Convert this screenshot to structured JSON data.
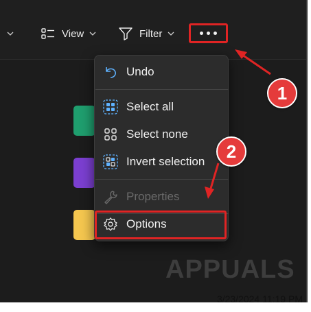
{
  "toolbar": {
    "view_label": "View",
    "filter_label": "Filter",
    "more_icon": "ellipsis-icon"
  },
  "context_menu": {
    "items": [
      {
        "label": "Undo",
        "icon": "undo-icon",
        "enabled": true
      },
      {
        "label": "Select all",
        "icon": "select-all-icon",
        "enabled": true
      },
      {
        "label": "Select none",
        "icon": "select-none-icon",
        "enabled": true
      },
      {
        "label": "Invert selection",
        "icon": "invert-selection-icon",
        "enabled": true
      },
      {
        "label": "Properties",
        "icon": "wrench-icon",
        "enabled": false
      },
      {
        "label": "Options",
        "icon": "gear-icon",
        "enabled": true
      }
    ]
  },
  "annotations": {
    "step1": "1",
    "step2": "2",
    "highlight_color": "#e02424"
  },
  "watermark": "APPUALS",
  "timestamp": "3/23/2024 11:19 PM"
}
